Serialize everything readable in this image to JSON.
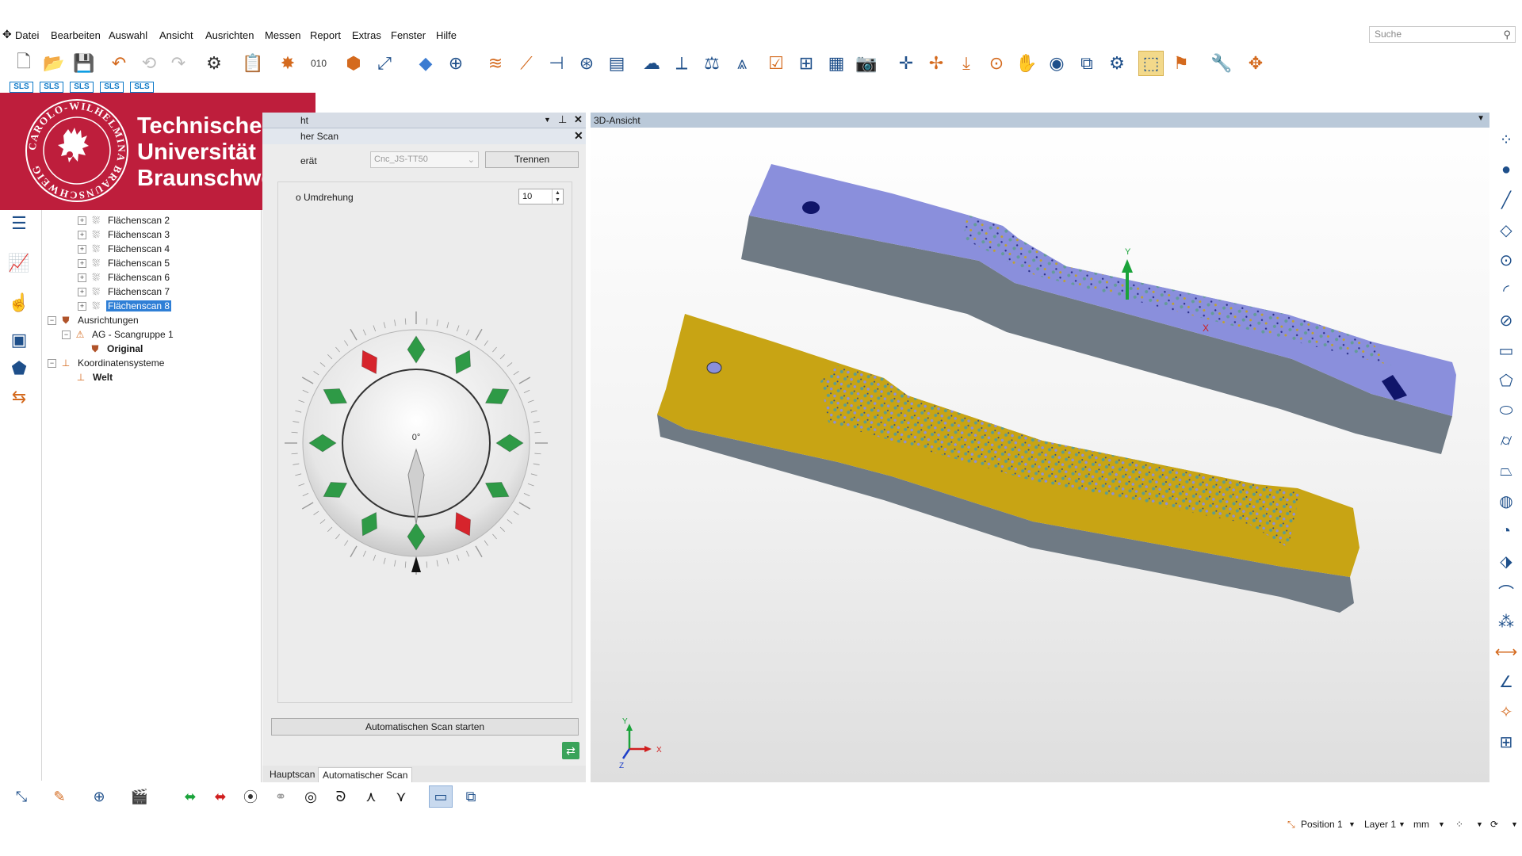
{
  "menu": [
    "Datei",
    "Bearbeiten",
    "Auswahl",
    "Ansicht",
    "Ausrichten",
    "Messen",
    "Report",
    "Extras",
    "Fenster",
    "Hilfe"
  ],
  "search": {
    "placeholder": "Suche"
  },
  "sls_labels": [
    "SLS",
    "SLS",
    "SLS",
    "SLS",
    "SLS"
  ],
  "logo": {
    "line1": "Technische",
    "line2": "Universität",
    "line3": "Braunschweig",
    "seal_text": "CAROLO-WILHELMINA BRAUNSCHWEIG"
  },
  "tree": {
    "items": [
      {
        "label": "Flächenscan 2",
        "type": "scan"
      },
      {
        "label": "Flächenscan 3",
        "type": "scan"
      },
      {
        "label": "Flächenscan 4",
        "type": "scan"
      },
      {
        "label": "Flächenscan 5",
        "type": "scan"
      },
      {
        "label": "Flächenscan 6",
        "type": "scan"
      },
      {
        "label": "Flächenscan 7",
        "type": "scan"
      },
      {
        "label": "Flächenscan 8",
        "type": "scan",
        "selected": true
      }
    ],
    "alignments": "Ausrichtungen",
    "scangroup": "AG - Scangruppe 1",
    "original": "Original",
    "coordsys": "Koordinatensysteme",
    "world": "Welt"
  },
  "mid_panel": {
    "header_title": "ht",
    "sub_title": "her Scan",
    "device_label": "erät",
    "device_value": "Cnc_JS-TT50",
    "disconnect_label": "Trennen",
    "rotation_label": "o Umdrehung",
    "rotation_value": "10",
    "dial_angle": "0°",
    "start_button": "Automatischen Scan starten",
    "tabs": [
      "Hauptscan",
      "Automatischer Scan"
    ],
    "active_tab": "Automatischer Scan"
  },
  "view3d": {
    "title": "3D-Ansicht",
    "axis_y": "Y",
    "axis_x": "X",
    "axis_z": "Z"
  },
  "status": {
    "position": "Position 1",
    "layer": "Layer 1",
    "unit": "mm"
  },
  "colors": {
    "tu_red": "#be1e3c",
    "scan_blue": "#8a8fdc",
    "scan_yellow": "#c8a414",
    "selection": "#2f7fd6",
    "dial_green": "#2e9a46",
    "dial_red": "#d6242c"
  }
}
